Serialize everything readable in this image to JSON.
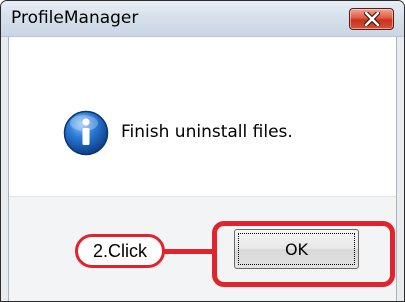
{
  "window": {
    "title": "ProfileManager",
    "close_icon": "close-x-icon"
  },
  "message": {
    "icon": "information-icon",
    "text": "Finish uninstall files."
  },
  "buttons": {
    "ok_label": "OK"
  },
  "annotation": {
    "callout_text": "2.Click",
    "highlight_color": "#e2232b"
  },
  "colors": {
    "close_button": "#d4533a",
    "info_icon": "#1a5fb4"
  }
}
